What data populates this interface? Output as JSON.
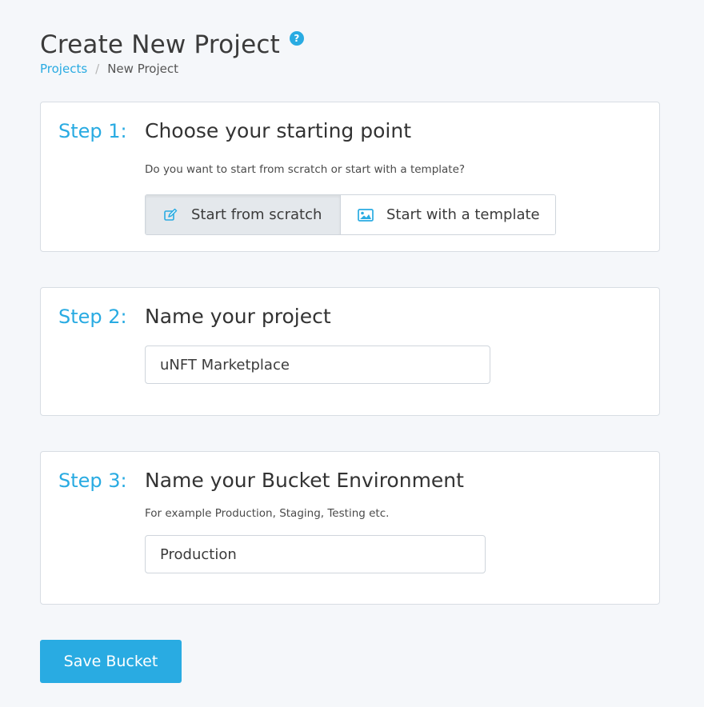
{
  "header": {
    "title": "Create New Project",
    "help_icon": "question-circle-icon"
  },
  "breadcrumb": {
    "items": [
      {
        "label": "Projects"
      },
      {
        "label": "New Project"
      }
    ],
    "separator": "/"
  },
  "steps": [
    {
      "label": "Step 1:",
      "title": "Choose your starting point",
      "description": "Do you want to start from scratch or start with a template?",
      "options": [
        {
          "label": "Start from scratch",
          "icon": "edit-icon",
          "selected": true
        },
        {
          "label": "Start with a template",
          "icon": "image-icon",
          "selected": false
        }
      ]
    },
    {
      "label": "Step 2:",
      "title": "Name your project",
      "input_value": "uNFT Marketplace"
    },
    {
      "label": "Step 3:",
      "title": "Name your Bucket Environment",
      "description": "For example Production, Staging, Testing etc.",
      "input_value": "Production"
    }
  ],
  "actions": {
    "save_label": "Save Bucket"
  },
  "colors": {
    "accent": "#29abe2",
    "background": "#f5f7fa",
    "card_border": "#d8dde3",
    "selected_option_bg": "#e4e8ec"
  }
}
